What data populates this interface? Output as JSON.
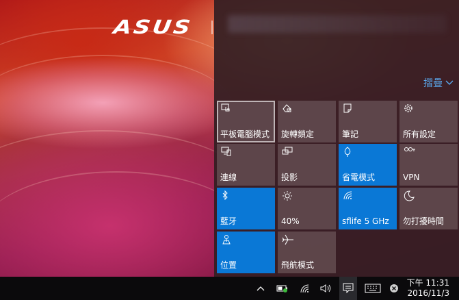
{
  "desktop": {
    "brand": "ASUS"
  },
  "action_center": {
    "collapse_label": "摺疊",
    "tiles": [
      {
        "label": "平板電腦模式",
        "icon": "tablet-mode-icon",
        "active": false
      },
      {
        "label": "旋轉鎖定",
        "icon": "rotation-lock-icon",
        "active": false
      },
      {
        "label": "筆記",
        "icon": "note-icon",
        "active": false
      },
      {
        "label": "所有設定",
        "icon": "gear-icon",
        "active": false
      },
      {
        "label": "連線",
        "icon": "connect-icon",
        "active": false
      },
      {
        "label": "投影",
        "icon": "project-icon",
        "active": false
      },
      {
        "label": "省電模式",
        "icon": "battery-saver-icon",
        "active": true
      },
      {
        "label": "VPN",
        "icon": "vpn-icon",
        "active": false
      },
      {
        "label": "藍牙",
        "icon": "bluetooth-icon",
        "active": true
      },
      {
        "label": "40%",
        "icon": "brightness-icon",
        "active": false
      },
      {
        "label": "sflife 5 GHz",
        "icon": "wifi-icon",
        "active": true
      },
      {
        "label": "勿打擾時間",
        "icon": "quiet-hours-icon",
        "active": false
      },
      {
        "label": "位置",
        "icon": "location-icon",
        "active": true
      },
      {
        "label": "飛航模式",
        "icon": "airplane-icon",
        "active": false
      }
    ]
  },
  "taskbar": {
    "clock_time": "下午 11:31",
    "clock_date": "2016/11/3"
  }
}
